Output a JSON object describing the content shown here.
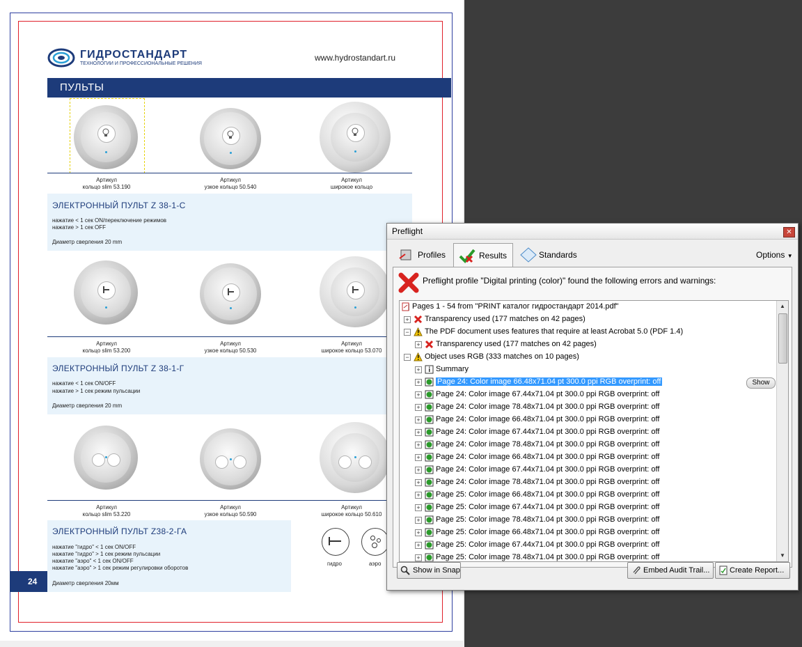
{
  "document": {
    "brand_name": "ГИДРОСТАНДАРТ",
    "brand_tagline": "ТЕХНОЛОГИИ И ПРОФЕССИОНАЛЬНЫЕ РЕШЕНИЯ",
    "website": "www.hydrostandart.ru",
    "section_title": "ПУЛЬТЫ",
    "page_number": "24",
    "captions": {
      "row1": [
        {
          "l1": "Артикул",
          "l2": "кольцо slim 53.190"
        },
        {
          "l1": "Артикул",
          "l2": "узкое кольцо 50.540"
        },
        {
          "l1": "Артикул",
          "l2": "широкое кольцо"
        }
      ],
      "row2": [
        {
          "l1": "Артикул",
          "l2": "кольцо slim 53.200"
        },
        {
          "l1": "Артикул",
          "l2": "узкое кольцо 50.530"
        },
        {
          "l1": "Артикул",
          "l2": "широкое кольцо 53.070"
        }
      ],
      "row3": [
        {
          "l1": "Артикул",
          "l2": "кольцо slim 53.220"
        },
        {
          "l1": "Артикул",
          "l2": "узкое кольцо 50.590"
        },
        {
          "l1": "Артикул",
          "l2": "широкое кольцо 50.610"
        }
      ]
    },
    "block1": {
      "title": "ЭЛЕКТРОННЫЙ ПУЛЬТ Z 38-1-С",
      "line1": "нажатие < 1 сек ON/переключение режимов",
      "line2": "нажатие > 1 сек OFF",
      "line3": "Диаметр сверления 20 mm"
    },
    "block2": {
      "title": "ЭЛЕКТРОННЫЙ ПУЛЬТ Z 38-1-Г",
      "line1": "нажатие < 1 сек ON/OFF",
      "line2": "нажатие > 1 сек режим пульсации",
      "line3": "Диаметр сверления 20 mm"
    },
    "block3": {
      "title": "ЭЛЕКТРОННЫЙ ПУЛЬТ Z38-2-ГА",
      "line1": "нажатие \"гидро\" < 1 сек  ON/OFF",
      "line2": "нажатие \"гидро\" > 1 сек режим пульсации",
      "line3": "нажатие \"аэро\" < 1 сек  ON/OFF",
      "line4": "нажатие \"аэро\" > 1 сек режим регулировки оборотов",
      "line5": "Диаметр сверления 20мм"
    },
    "icon_labels": {
      "hydro": "гидро",
      "aero": "аэро"
    }
  },
  "preflight": {
    "title": "Preflight",
    "tabs": {
      "profiles": "Profiles",
      "results": "Results",
      "standards": "Standards"
    },
    "options": "Options",
    "summary": "Preflight profile \"Digital printing (color)\" found the following errors and warnings:",
    "tree": {
      "root": "Pages 1 - 54 from \"PRINT каталог гидростандарт 2014.pdf\"",
      "transparency": "Transparency used (177 matches on 42 pages)",
      "acrobat": "The PDF document uses features that require at least Acrobat 5.0 (PDF 1.4)",
      "transparency_nested": "Transparency used (177 matches on 42 pages)",
      "rgb": "Object uses RGB (333 matches on 10 pages)",
      "summary_item": "Summary",
      "items": [
        "Page 24: Color image 66.48x71.04 pt 300.0 ppi RGB  overprint: off",
        "Page 24: Color image 67.44x71.04 pt 300.0 ppi RGB  overprint: off",
        "Page 24: Color image 78.48x71.04 pt 300.0 ppi RGB  overprint: off",
        "Page 24: Color image 66.48x71.04 pt 300.0 ppi RGB  overprint: off",
        "Page 24: Color image 67.44x71.04 pt 300.0 ppi RGB  overprint: off",
        "Page 24: Color image 78.48x71.04 pt 300.0 ppi RGB  overprint: off",
        "Page 24: Color image 66.48x71.04 pt 300.0 ppi RGB  overprint: off",
        "Page 24: Color image 67.44x71.04 pt 300.0 ppi RGB  overprint: off",
        "Page 24: Color image 78.48x71.04 pt 300.0 ppi RGB  overprint: off",
        "Page 25: Color image 66.48x71.04 pt 300.0 ppi RGB  overprint: off",
        "Page 25: Color image 67.44x71.04 pt 300.0 ppi RGB  overprint: off",
        "Page 25: Color image 78.48x71.04 pt 300.0 ppi RGB  overprint: off",
        "Page 25: Color image 66.48x71.04 pt 300.0 ppi RGB  overprint: off",
        "Page 25: Color image 67.44x71.04 pt 300.0 ppi RGB  overprint: off",
        "Page 25: Color image 78.48x71.04 pt 300.0 ppi RGB  overprint: off"
      ]
    },
    "show_button": "Show",
    "buttons": {
      "show_in_snap": "Show in Snap",
      "embed_audit": "Embed Audit Trail...",
      "create_report": "Create Report..."
    },
    "colors": {
      "error": "#d8231f",
      "warning": "#f2c400",
      "selection": "#3399ff",
      "brand": "#1d3b7a"
    }
  }
}
